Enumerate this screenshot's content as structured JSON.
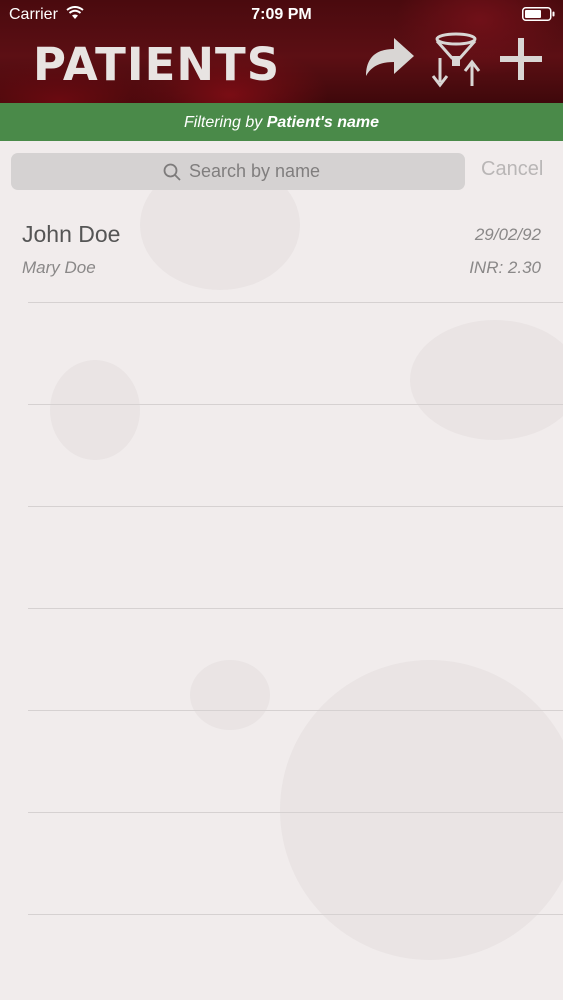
{
  "status_bar": {
    "carrier": "Carrier",
    "time": "7:09 PM"
  },
  "header": {
    "title": "PATIENTS",
    "icons": [
      "share-icon",
      "sort-filter-icon",
      "add-icon"
    ]
  },
  "filter_banner": {
    "prefix": "Filtering by ",
    "field": "Patient's name",
    "color": "#4a8a49"
  },
  "search": {
    "placeholder": "Search by name",
    "value": "",
    "cancel_label": "Cancel"
  },
  "patients": [
    {
      "name": "John Doe",
      "date": "29/02/92",
      "subtitle": "Mary Doe",
      "inr": "INR: 2.30"
    }
  ],
  "colors": {
    "header_red": "#5c0f14",
    "background": "#f1ecec"
  }
}
